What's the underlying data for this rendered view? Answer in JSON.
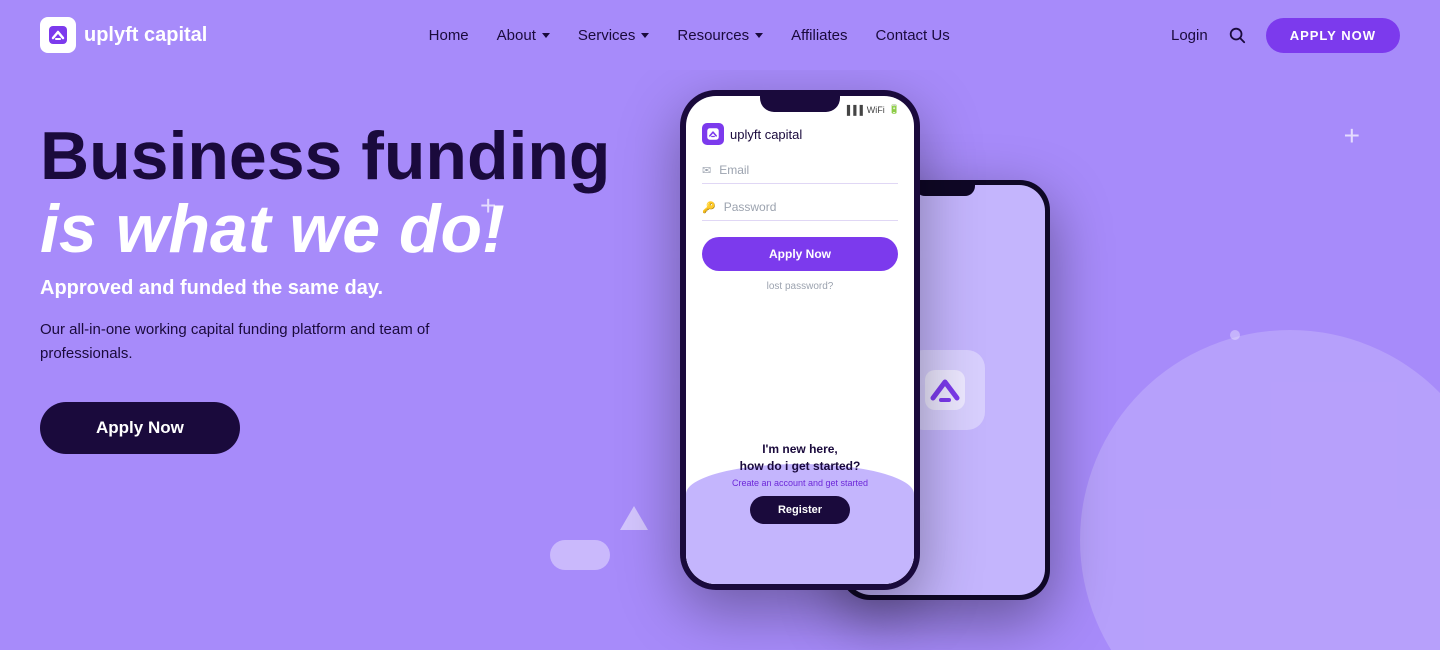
{
  "brand": {
    "name": "uplyft capital",
    "logo_alt": "uplyft capital logo"
  },
  "nav": {
    "home": "Home",
    "about": "About",
    "services": "Services",
    "resources": "Resources",
    "affiliates": "Affiliates",
    "contact": "Contact Us",
    "login": "Login",
    "apply_btn": "APPLY NOW"
  },
  "hero": {
    "title_line1": "Business funding",
    "title_line2": "is what we do!",
    "subtitle": "Approved and funded the same day.",
    "description": "Our all-in-one working capital funding platform and team of professionals.",
    "apply_btn": "Apply Now"
  },
  "phone_app": {
    "logo_text": "uplyft",
    "logo_subtext": " capital",
    "email_placeholder": "Email",
    "password_placeholder": "Password",
    "apply_btn": "Apply Now",
    "lost_password": "lost password?",
    "new_user_title": "I'm new here,\nhow do i get started?",
    "create_account": "Create an account and get started",
    "register_btn": "Register"
  },
  "decorations": {
    "plus1": "+",
    "plus2": "+"
  }
}
